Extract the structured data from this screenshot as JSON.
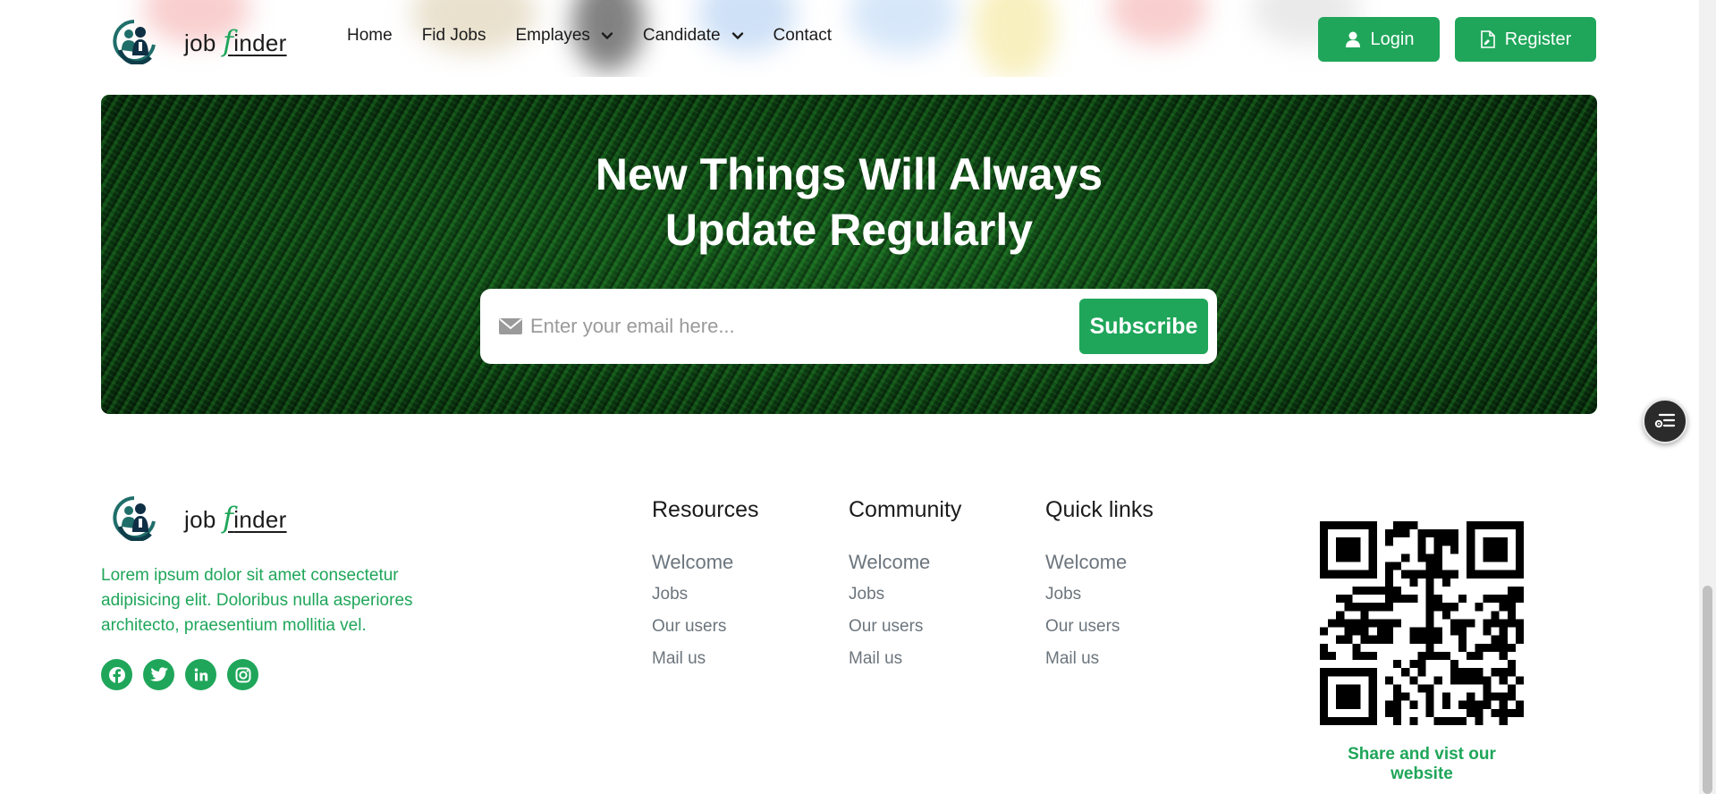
{
  "brand": {
    "name_prefix": "job ",
    "name_f": "f",
    "name_rest": "inder",
    "accent_color": "#1fa65a",
    "logo_icon": "people-logo-icon"
  },
  "nav": {
    "items": [
      {
        "label": "Home",
        "dropdown": false
      },
      {
        "label": "Fid Jobs",
        "dropdown": false
      },
      {
        "label": "Emplayes",
        "dropdown": true
      },
      {
        "label": "Candidate",
        "dropdown": true
      },
      {
        "label": "Contact",
        "dropdown": false
      }
    ],
    "login_label": "Login",
    "register_label": "Register"
  },
  "newsletter": {
    "title_line1": "New Things Will Always",
    "title_line2": "Update Regularly",
    "email_placeholder": "Enter your email here...",
    "subscribe_label": "Subscribe"
  },
  "footer": {
    "about": "Lorem ipsum dolor sit amet consectetur adipisicing elit. Doloribus nulla asperiores architecto, praesentium mollitia vel.",
    "socials": [
      "facebook-icon",
      "twitter-icon",
      "linkedin-icon",
      "instagram-icon"
    ],
    "columns": [
      {
        "title": "Resources",
        "links": [
          "Welcome",
          "Jobs",
          "Our users",
          "Mail us"
        ]
      },
      {
        "title": "Community",
        "links": [
          "Welcome",
          "Jobs",
          "Our users",
          "Mail us"
        ]
      },
      {
        "title": "Quick links",
        "links": [
          "Welcome",
          "Jobs",
          "Our users",
          "Mail us"
        ]
      }
    ],
    "qr_caption": "Share and vist our website"
  }
}
